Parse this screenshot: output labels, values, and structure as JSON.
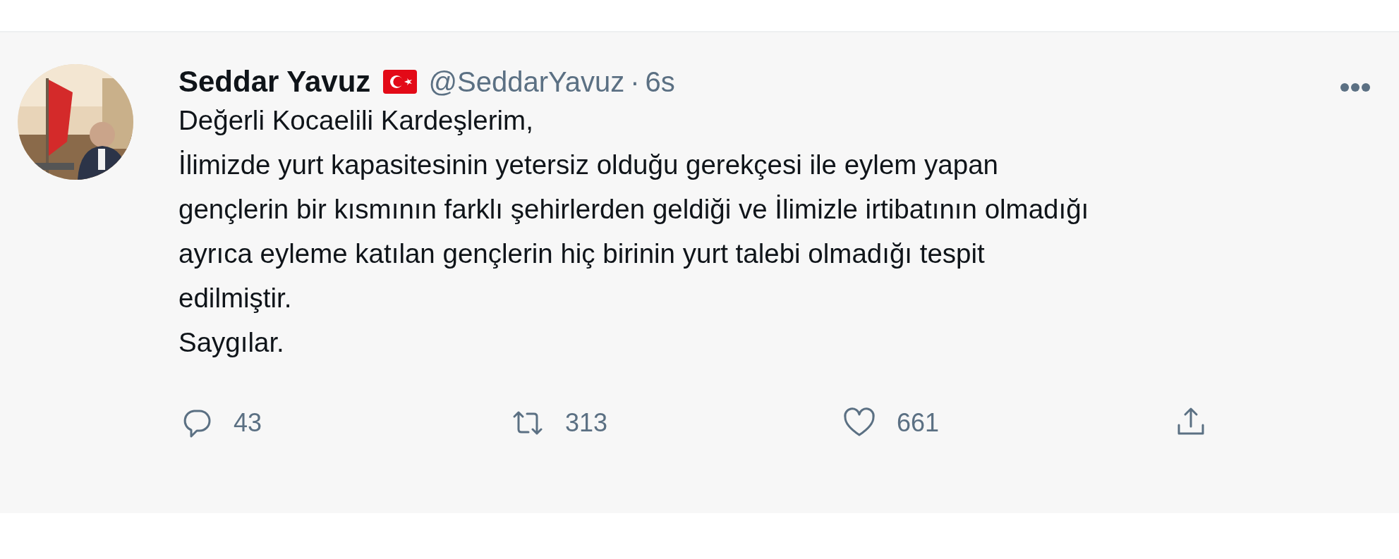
{
  "tweet": {
    "author": {
      "name": "Seddar Yavuz",
      "handle": "@SeddarYavuz",
      "separator": "·",
      "time": "6s"
    },
    "body_lines": [
      "Değerli Kocaelili Kardeşlerim,",
      "İlimizde yurt kapasitesinin yetersiz olduğu gerekçesi ile eylem yapan",
      "gençlerin bir kısmının farklı şehirlerden geldiği ve İlimizle irtibatının olmadığı",
      "ayrıca eyleme katılan gençlerin hiç birinin yurt talebi olmadığı tespit",
      "edilmiştir.",
      "Saygılar."
    ],
    "actions": [
      {
        "kind": "reply",
        "count": "43"
      },
      {
        "kind": "retweet",
        "count": "313"
      },
      {
        "kind": "like",
        "count": "661"
      },
      {
        "kind": "share"
      }
    ]
  }
}
